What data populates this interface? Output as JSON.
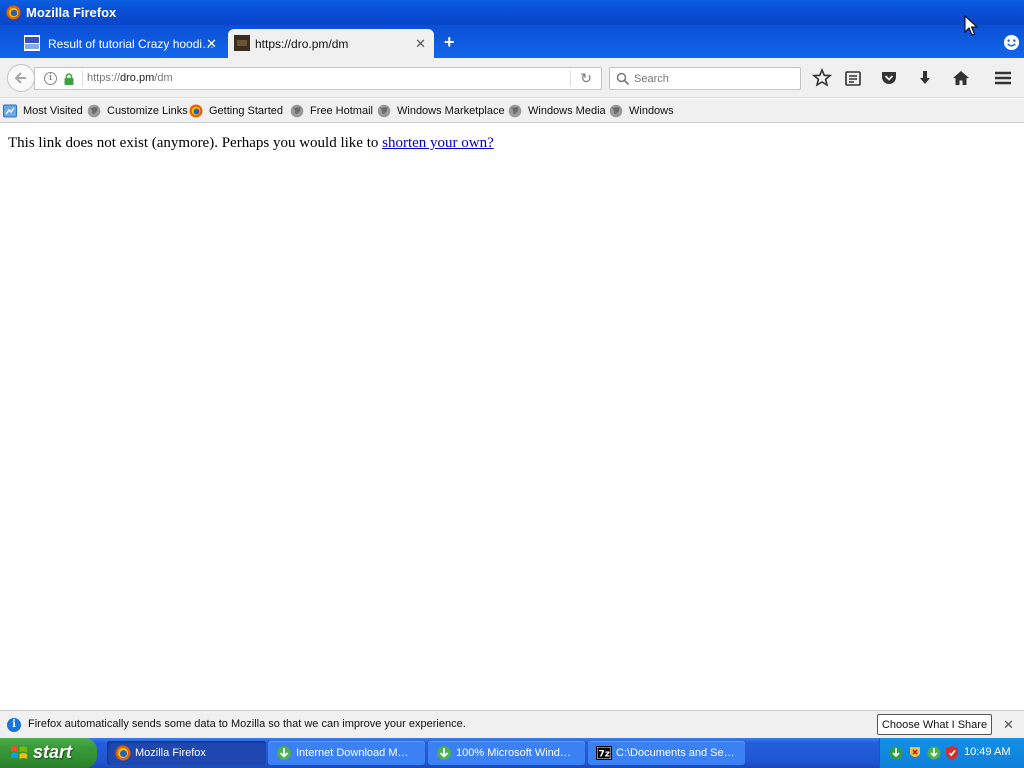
{
  "window": {
    "title": "Mozilla Firefox"
  },
  "tabs": [
    {
      "label": "Result of tutorial Crazy hoodi…",
      "active": false
    },
    {
      "label": "https://dro.pm/dm",
      "active": true
    }
  ],
  "navbar": {
    "url_scheme": "https://",
    "url_host": "dro.pm",
    "url_path": "/dm",
    "search_placeholder": "Search"
  },
  "bookmarks": [
    {
      "label": "Most Visited",
      "icon": "most-visited-icon"
    },
    {
      "label": "Customize Links",
      "icon": "globe-icon"
    },
    {
      "label": "Getting Started",
      "icon": "firefox-icon"
    },
    {
      "label": "Free Hotmail",
      "icon": "globe-icon"
    },
    {
      "label": "Windows Marketplace",
      "icon": "globe-icon"
    },
    {
      "label": "Windows Media",
      "icon": "globe-icon"
    },
    {
      "label": "Windows",
      "icon": "globe-icon"
    }
  ],
  "content": {
    "message": "This link does not exist (anymore). Perhaps you would like to",
    "link_text": "shorten your own?"
  },
  "notification": {
    "message": "Firefox automatically sends some data to Mozilla so that we can improve your experience.",
    "button_label": "Choose What I Share"
  },
  "taskbar": {
    "start_label": "start",
    "tasks": [
      {
        "label": "Mozilla Firefox",
        "active": true
      },
      {
        "label": "Internet Download M…",
        "active": false
      },
      {
        "label": "100% Microsoft Wind…",
        "active": false
      },
      {
        "label": "C:\\Documents and Se…",
        "active": false
      }
    ],
    "clock": "10:49 AM"
  },
  "colors": {
    "titlebar": "#0a4fd6",
    "link": "#0000cc",
    "start_green": "#3a9a3a",
    "taskbar_blue": "#245edb"
  }
}
